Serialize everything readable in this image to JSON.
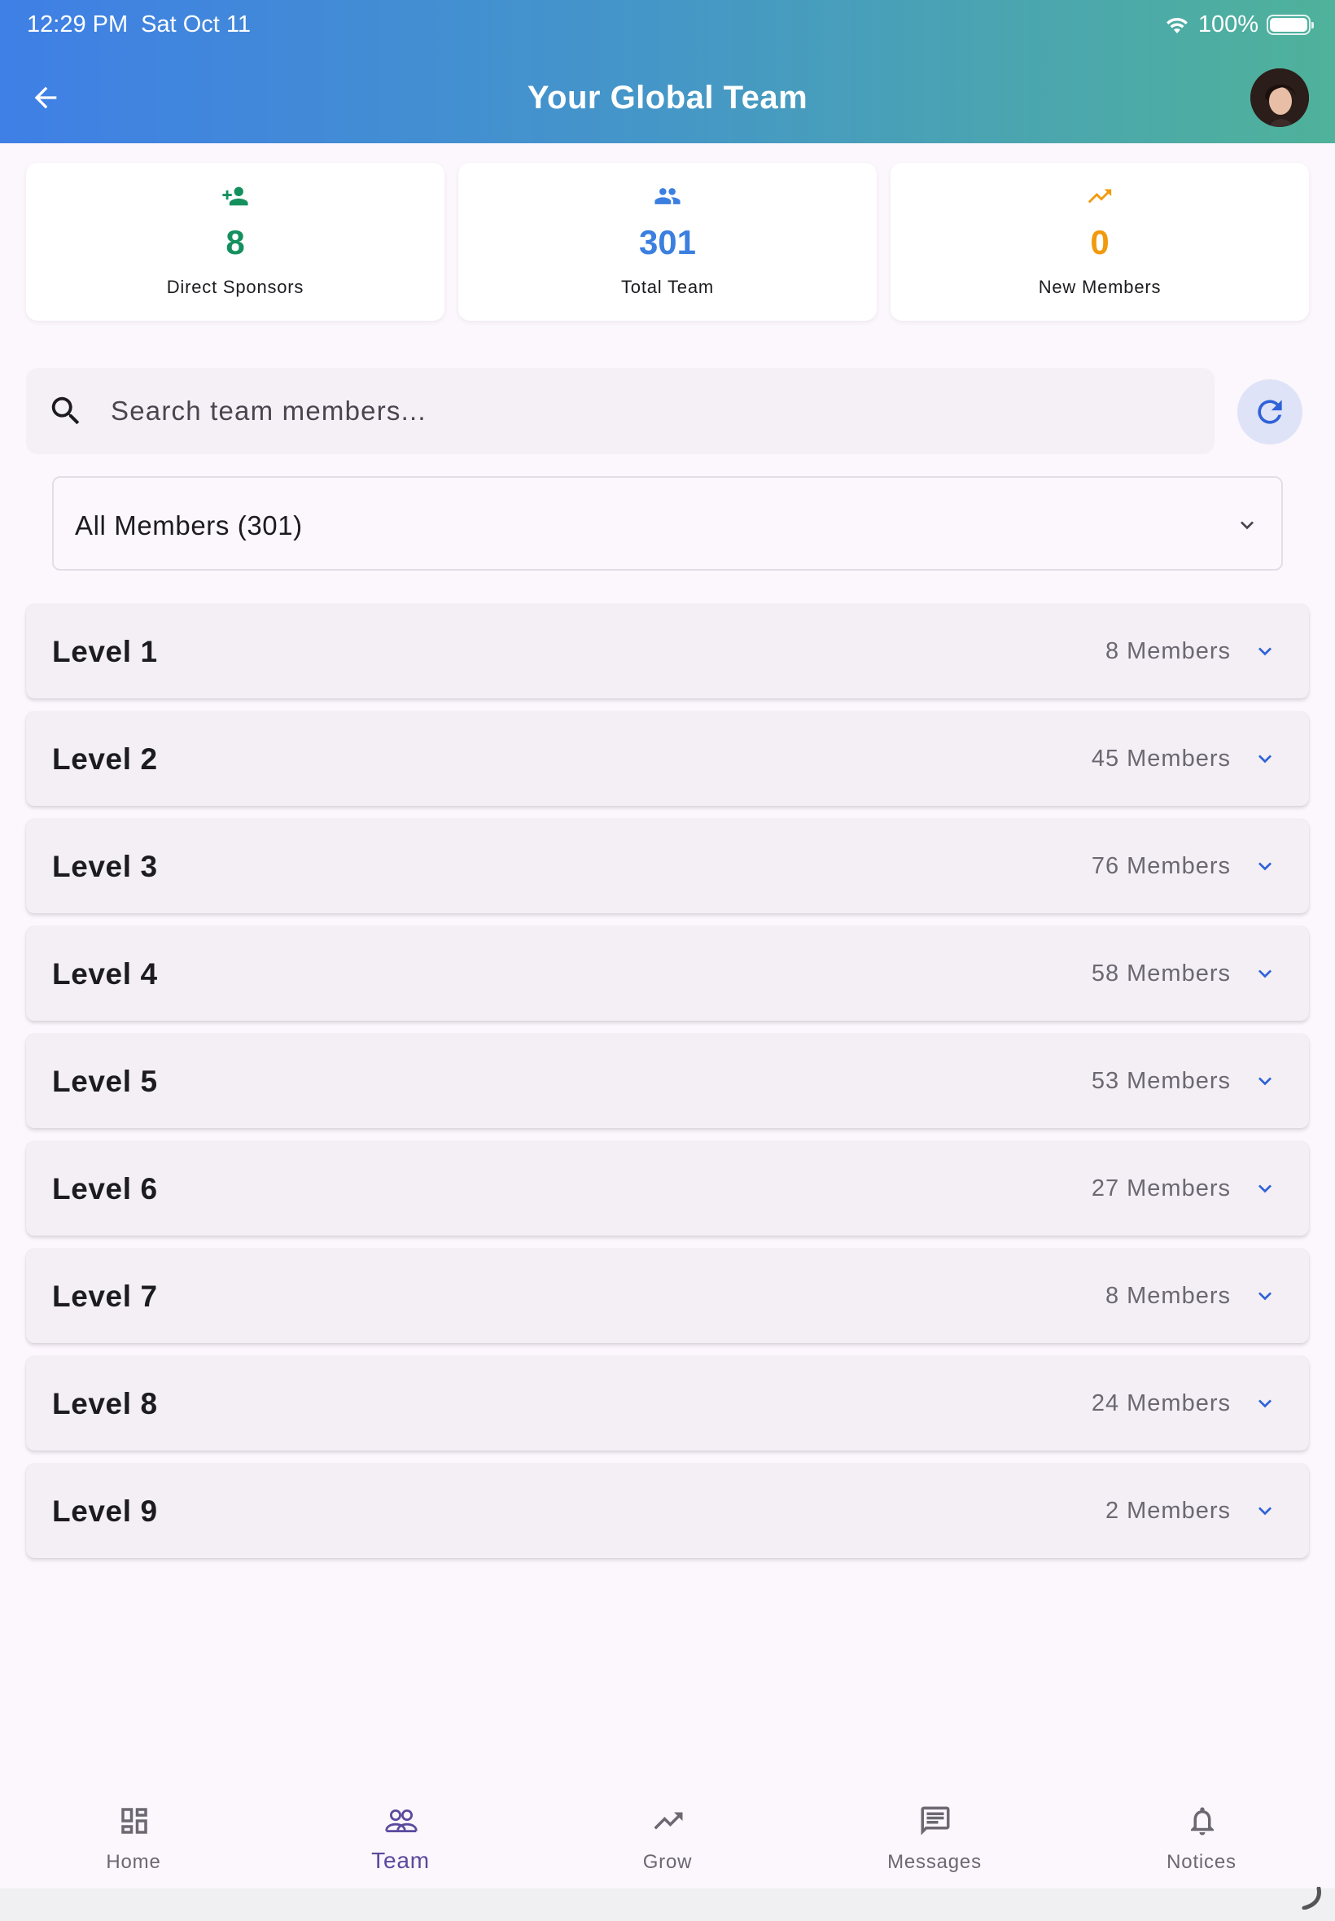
{
  "status_bar": {
    "time": "12:29 PM",
    "date": "Sat Oct 11",
    "battery": "100%"
  },
  "header": {
    "title": "Your Global Team"
  },
  "stats": [
    {
      "icon": "person-add-icon",
      "value": "8",
      "label": "Direct Sponsors",
      "color": "#14905e"
    },
    {
      "icon": "group-icon",
      "value": "301",
      "label": "Total Team",
      "color": "#3b7fe0"
    },
    {
      "icon": "trending-up-icon",
      "value": "0",
      "label": "New Members",
      "color": "#f29a0e"
    }
  ],
  "search": {
    "placeholder": "Search team members..."
  },
  "filter": {
    "selected": "All Members (301)"
  },
  "levels": [
    {
      "title": "Level 1",
      "count": "8 Members"
    },
    {
      "title": "Level 2",
      "count": "45 Members"
    },
    {
      "title": "Level 3",
      "count": "76 Members"
    },
    {
      "title": "Level 4",
      "count": "58 Members"
    },
    {
      "title": "Level 5",
      "count": "53 Members"
    },
    {
      "title": "Level 6",
      "count": "27 Members"
    },
    {
      "title": "Level 7",
      "count": "8 Members"
    },
    {
      "title": "Level 8",
      "count": "24 Members"
    },
    {
      "title": "Level 9",
      "count": "2 Members"
    }
  ],
  "nav": [
    {
      "label": "Home",
      "icon": "dashboard-icon"
    },
    {
      "label": "Team",
      "icon": "team-icon"
    },
    {
      "label": "Grow",
      "icon": "trending-up-icon"
    },
    {
      "label": "Messages",
      "icon": "message-icon"
    },
    {
      "label": "Notices",
      "icon": "bell-icon"
    }
  ],
  "colors": {
    "accent": "#3b5bd6",
    "active_nav": "#5a4a9c"
  }
}
